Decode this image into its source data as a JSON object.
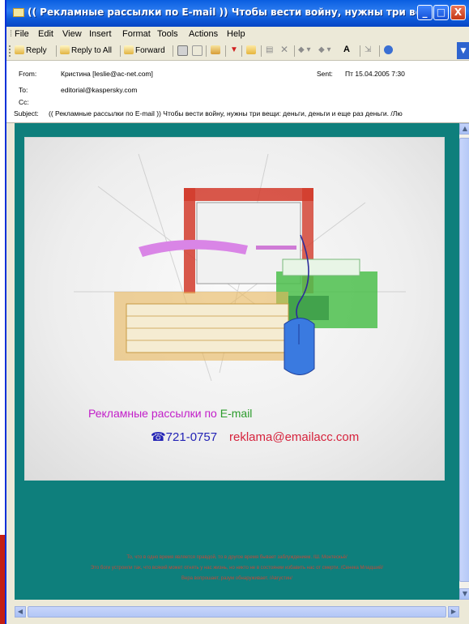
{
  "window": {
    "title": "(( Рекламные рассылки по E-mail )) Чтобы вести войну, нужны три вещи: деньги, ..."
  },
  "titlebar_buttons": {
    "minimize": "_",
    "maximize": "□",
    "close": "X"
  },
  "menu": [
    "File",
    "Edit",
    "View",
    "Insert",
    "Format",
    "Tools",
    "Actions",
    "Help"
  ],
  "toolbar": {
    "reply": "Reply",
    "reply_all": "Reply to All",
    "forward": "Forward",
    "icons": [
      "print-icon",
      "copy-icon",
      "move-icon",
      "flag-icon",
      "open-folder-icon",
      "rules-icon",
      "delete-icon",
      "previous-icon",
      "next-icon",
      "font-size-icon",
      "translate-icon",
      "help-icon"
    ],
    "font_label": "A"
  },
  "header": {
    "from_label": "From:",
    "from_value": "Кристина [leslie@ac-net.com]",
    "sent_label": "Sent:",
    "sent_value": "Пт 15.04.2005 7:30",
    "to_label": "To:",
    "to_value": "editorial@kaspersky.com",
    "cc_label": "Cc:",
    "cc_value": "",
    "subject_label": "Subject:",
    "subject_value": "(( Рекламные рассылки по E-mail )) Чтобы вести войну, нужны три вещи: деньги, деньги и еще раз деньги. /Лю"
  },
  "ad": {
    "headline_part1": "Рекламные рассылки по ",
    "headline_part2": "E-mail",
    "phone": "☎721-0757",
    "email": "reklama@emailacc.com"
  },
  "footer_quotes": [
    "То, что в одно время является правдой, то в другое время бывает заблуждением. /Ш. Монтескьё/",
    "Это боги устроили так, что всякий может отнять у нас жизнь, но никто не в состоянии избавить нас от смерти. /Сенека Младший/",
    "Вера вопрошает, разум обнаруживает. /Августин/"
  ],
  "colors": {
    "titlebar": "#0a5ee0",
    "body_bg": "#0e7f7c",
    "headline_purple": "#c21ec9",
    "headline_green": "#2c9c2c",
    "phone_blue": "#2323b5",
    "email_red": "#d6233d",
    "footer_text": "#c24a3a",
    "red_strip": "#c41f14"
  }
}
